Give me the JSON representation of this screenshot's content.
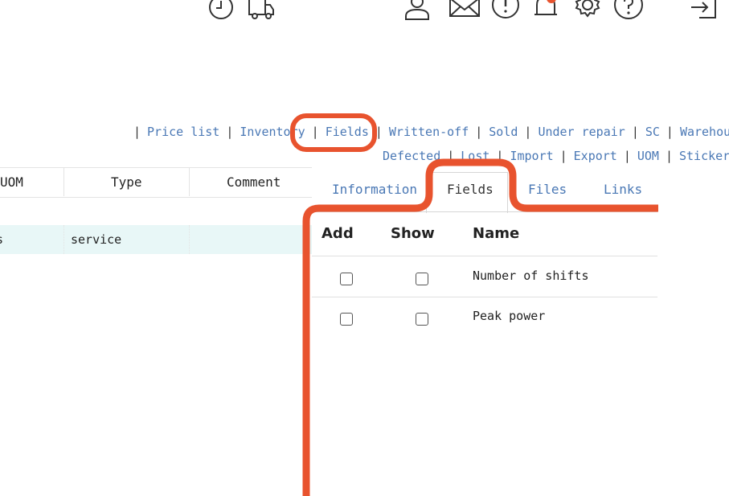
{
  "header": {
    "icons": [
      "clock-icon",
      "truck-icon",
      "user-icon",
      "mail-icon",
      "alert-icon",
      "bell-icon",
      "gear-icon",
      "help-icon",
      "logout-icon"
    ]
  },
  "nav": {
    "row1": [
      "Price list",
      "Inventory",
      "Fields",
      "Written-off",
      "Sold",
      "Under repair",
      "SC",
      "Warehouses"
    ],
    "row2": [
      "Defected",
      "Lost",
      "Import",
      "Export",
      "UOM",
      "Stickers"
    ],
    "separator": "|"
  },
  "left_table": {
    "columns": [
      "UOM",
      "Type",
      "Comment"
    ],
    "rows": [
      {
        "uom": "s",
        "type": "service",
        "comment": ""
      }
    ]
  },
  "panel": {
    "tabs": [
      "Information",
      "Fields",
      "Files",
      "Links"
    ],
    "active_tab": "Fields",
    "columns": [
      "Add",
      "Show",
      "Name"
    ],
    "fields": [
      {
        "add": false,
        "show": false,
        "name": "Number of shifts"
      },
      {
        "add": false,
        "show": false,
        "name": "Peak power"
      }
    ]
  },
  "colors": {
    "link": "#4a78b5",
    "highlight_row": "#e8f7f7",
    "annotation": "#e8532e",
    "notification": "#e8532e"
  }
}
